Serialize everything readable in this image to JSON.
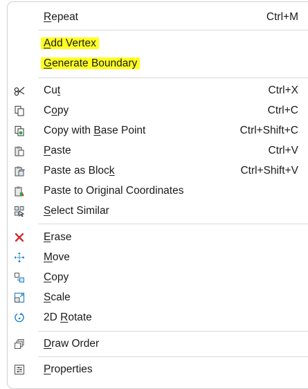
{
  "menu": {
    "repeat": {
      "pre": "",
      "u": "R",
      "post": "epeat",
      "accel": "Ctrl+M"
    },
    "add_vertex": {
      "pre": "",
      "u": "A",
      "post": "dd Vertex"
    },
    "generate_boundary": {
      "pre": "",
      "u": "G",
      "post": "enerate Boundary"
    },
    "cut": {
      "pre": "Cu",
      "u": "t",
      "post": "",
      "accel": "Ctrl+X"
    },
    "copy": {
      "pre": "C",
      "u": "o",
      "post": "py",
      "accel": "Ctrl+C"
    },
    "copy_base": {
      "pre": "Copy with ",
      "u": "B",
      "post": "ase Point",
      "accel": "Ctrl+Shift+C"
    },
    "paste": {
      "pre": "",
      "u": "P",
      "post": "aste",
      "accel": "Ctrl+V"
    },
    "paste_block": {
      "pre": "Paste as Bloc",
      "u": "k",
      "post": "",
      "accel": "Ctrl+Shift+V"
    },
    "paste_original": {
      "pre": "Paste to Ori",
      "u": "g",
      "post": "inal Coordinates"
    },
    "select_similar": {
      "pre": "",
      "u": "S",
      "post": "elect Similar"
    },
    "erase": {
      "pre": "",
      "u": "E",
      "post": "rase"
    },
    "move": {
      "pre": "",
      "u": "M",
      "post": "ove"
    },
    "copy2": {
      "pre": "",
      "u": "C",
      "post": "opy"
    },
    "scale": {
      "pre": "",
      "u": "S",
      "post": "cale"
    },
    "rotate": {
      "pre": "2D ",
      "u": "R",
      "post": "otate"
    },
    "draw_order": {
      "pre": "",
      "u": "D",
      "post": "raw Order"
    },
    "properties": {
      "pre": "",
      "u": "P",
      "post": "roperties"
    }
  },
  "icons": {
    "cut": "scissors-icon",
    "copy": "copy-icon",
    "copy_base": "copy-base-point-icon",
    "paste": "paste-icon",
    "paste_block": "paste-block-icon",
    "paste_original": "paste-original-icon",
    "select_similar": "select-similar-icon",
    "erase": "erase-icon",
    "move": "move-icon",
    "copy2": "copy-objects-icon",
    "scale": "scale-icon",
    "rotate": "rotate-icon",
    "draw_order": "draw-order-icon",
    "properties": "properties-icon"
  },
  "colors": {
    "highlight": "#ffff22",
    "erase": "#d8262b",
    "accent": "#1a7ec8"
  }
}
